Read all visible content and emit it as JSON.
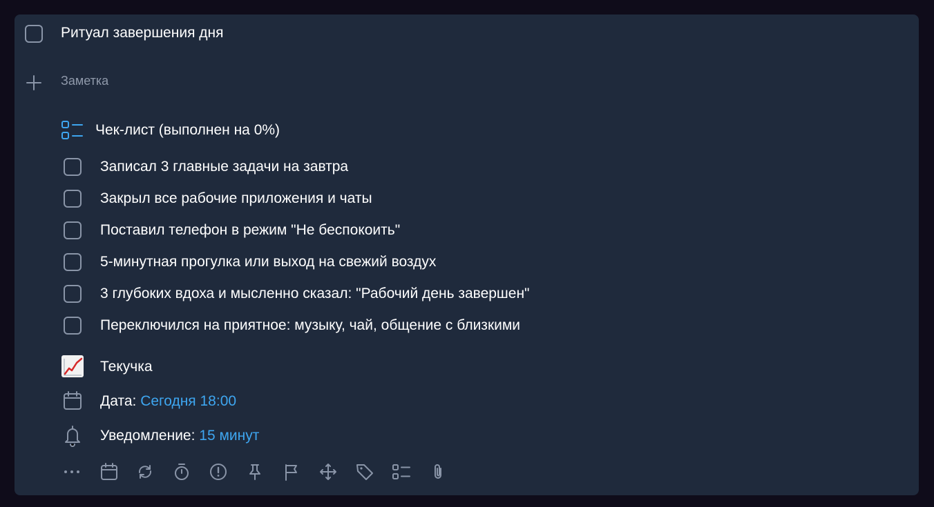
{
  "task": {
    "title": "Ритуал завершения дня",
    "note_placeholder": "Заметка"
  },
  "checklist": {
    "header": "Чек-лист (выполнен на 0%)",
    "items": [
      "Записал 3 главные задачи на завтра",
      "Закрыл все рабочие приложения и чаты",
      "Поставил телефон в режим \"Не беспокоить\"",
      "5-минутная прогулка или выход на свежий воздух",
      "3 глубоких вдоха и мысленно сказал: \"Рабочий день завершен\"",
      "Переключился на приятное: музыку, чай, общение с близкими"
    ]
  },
  "project": {
    "emoji": "📈",
    "name": "Текучка"
  },
  "date": {
    "label": "Дата:",
    "value": "Сегодня 18:00"
  },
  "reminder": {
    "label": "Уведомление:",
    "value": "15 минут"
  },
  "toolbar": {
    "icons": [
      "more-icon",
      "calendar-icon",
      "repeat-icon",
      "timer-icon",
      "priority-icon",
      "pin-icon",
      "flag-icon",
      "move-icon",
      "tag-icon",
      "checklist-icon",
      "attach-icon"
    ]
  },
  "colors": {
    "background": "#0f0c1a",
    "card": "#1f2a3c",
    "accent": "#3ea6f0",
    "muted": "#8f99aa"
  }
}
